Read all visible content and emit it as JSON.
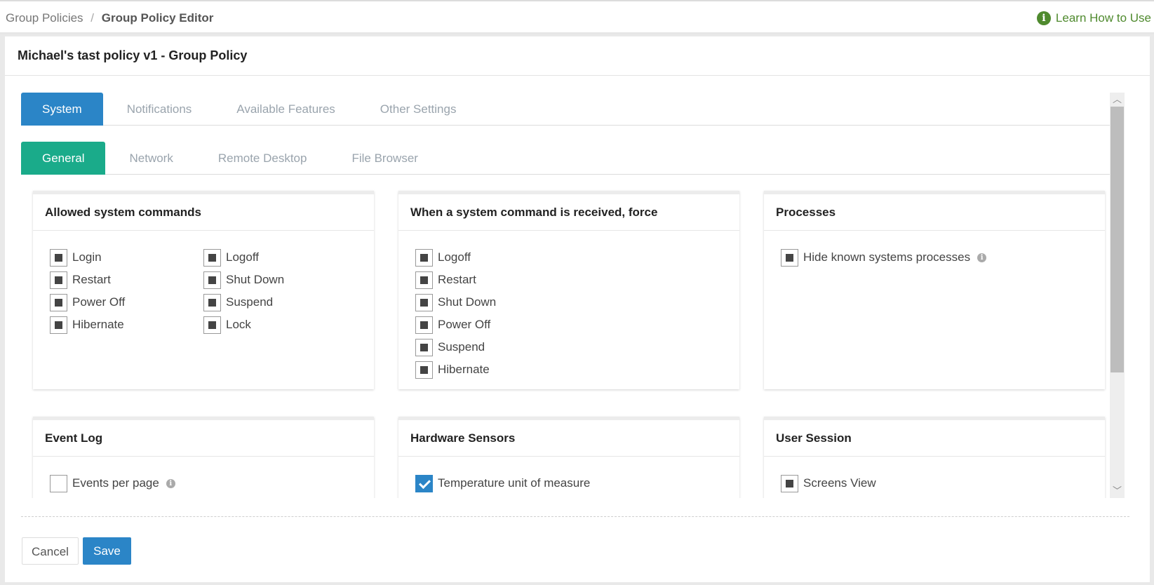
{
  "breadcrumb": {
    "parent": "Group Policies",
    "separator": "/",
    "current": "Group Policy Editor"
  },
  "help": {
    "icon": "info-circle-icon",
    "label": "Learn How to Use"
  },
  "panel_title": "Michael's tast policy v1 - Group Policy",
  "main_tabs": [
    {
      "label": "System",
      "active": true
    },
    {
      "label": "Notifications",
      "active": false
    },
    {
      "label": "Available Features",
      "active": false
    },
    {
      "label": "Other Settings",
      "active": false
    }
  ],
  "sub_tabs": [
    {
      "label": "General",
      "active": true
    },
    {
      "label": "Network",
      "active": false
    },
    {
      "label": "Remote Desktop",
      "active": false
    },
    {
      "label": "File Browser",
      "active": false
    }
  ],
  "cards": {
    "allowed_commands": {
      "title": "Allowed system commands",
      "left": [
        {
          "label": "Login",
          "state": "indeterminate"
        },
        {
          "label": "Restart",
          "state": "indeterminate"
        },
        {
          "label": "Power Off",
          "state": "indeterminate"
        },
        {
          "label": "Hibernate",
          "state": "indeterminate"
        }
      ],
      "right": [
        {
          "label": "Logoff",
          "state": "indeterminate"
        },
        {
          "label": "Shut Down",
          "state": "indeterminate"
        },
        {
          "label": "Suspend",
          "state": "indeterminate"
        },
        {
          "label": "Lock",
          "state": "indeterminate"
        }
      ]
    },
    "force": {
      "title": "When a system command is received, force",
      "items": [
        {
          "label": "Logoff",
          "state": "indeterminate"
        },
        {
          "label": "Restart",
          "state": "indeterminate"
        },
        {
          "label": "Shut Down",
          "state": "indeterminate"
        },
        {
          "label": "Power Off",
          "state": "indeterminate"
        },
        {
          "label": "Suspend",
          "state": "indeterminate"
        },
        {
          "label": "Hibernate",
          "state": "indeterminate"
        }
      ]
    },
    "processes": {
      "title": "Processes",
      "items": [
        {
          "label": "Hide known systems processes",
          "state": "indeterminate"
        }
      ]
    },
    "event_log": {
      "title": "Event Log",
      "items": [
        {
          "label": "Events per page",
          "state": "unchecked"
        }
      ]
    },
    "hardware_sensors": {
      "title": "Hardware Sensors",
      "items": [
        {
          "label": "Temperature unit of measure",
          "state": "checked"
        }
      ]
    },
    "user_session": {
      "title": "User Session",
      "items": [
        {
          "label": "Screens View",
          "state": "indeterminate"
        }
      ]
    }
  },
  "footer": {
    "cancel_label": "Cancel",
    "save_label": "Save"
  },
  "colors": {
    "primary_blue": "#2b85c7",
    "tab_green": "#1aab8a",
    "help_green": "#4f8a2e"
  }
}
